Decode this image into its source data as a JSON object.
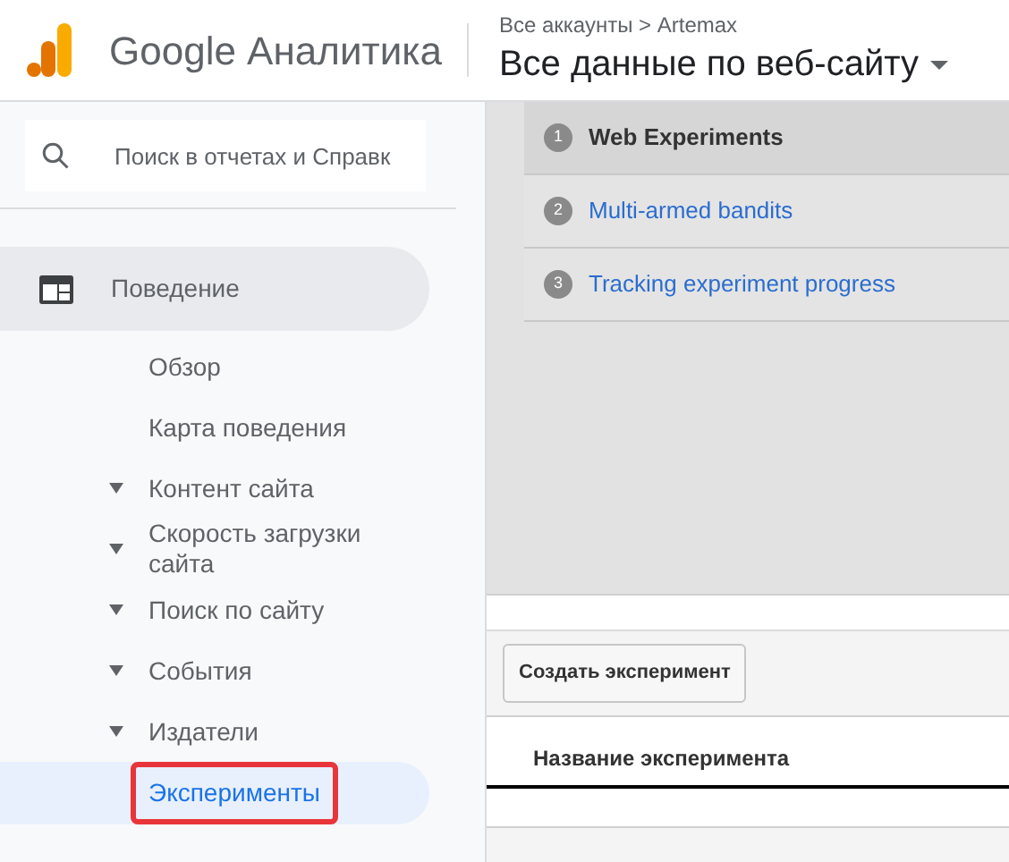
{
  "header": {
    "product": "Google Аналитика",
    "breadcrumb": "Все аккаунты > Artemax",
    "view_title": "Все данные по веб-сайту"
  },
  "search": {
    "placeholder": "Поиск в отчетах и Справк"
  },
  "sidebar": {
    "section": {
      "label": "Поведение",
      "expanded": true
    },
    "items": [
      {
        "label": "Обзор",
        "has_children": false,
        "selected": false
      },
      {
        "label": "Карта поведения",
        "has_children": false,
        "selected": false
      },
      {
        "label": "Контент сайта",
        "has_children": true,
        "selected": false
      },
      {
        "label": "Скорость загрузки сайта",
        "has_children": true,
        "selected": false
      },
      {
        "label": "Поиск по сайту",
        "has_children": true,
        "selected": false
      },
      {
        "label": "События",
        "has_children": true,
        "selected": false
      },
      {
        "label": "Издатели",
        "has_children": true,
        "selected": false
      },
      {
        "label": "Эксперименты",
        "has_children": false,
        "selected": true
      }
    ]
  },
  "steps": [
    {
      "number": "1",
      "label": "Web Experiments",
      "selected": true
    },
    {
      "number": "2",
      "label": "Multi-armed bandits",
      "selected": false
    },
    {
      "number": "3",
      "label": "Tracking experiment progress",
      "selected": false
    }
  ],
  "create_button": "Создать эксперимент",
  "table": {
    "columns": [
      "Название эксперимента"
    ]
  }
}
